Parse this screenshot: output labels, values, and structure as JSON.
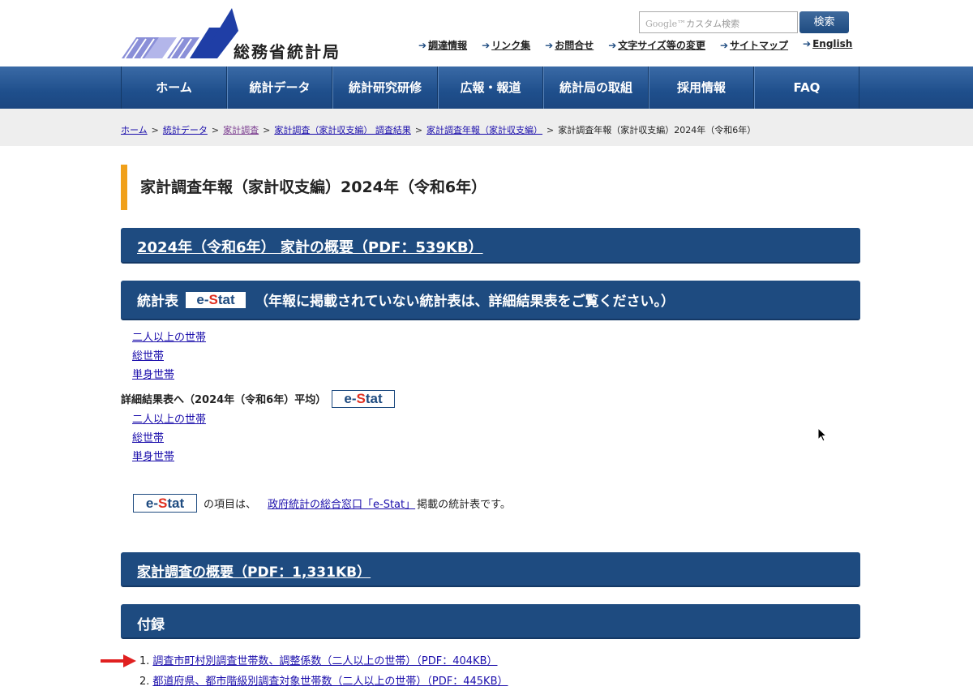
{
  "header": {
    "logo_text": "総務省統計局",
    "search_placeholder_brand": "Google™",
    "search_placeholder": "カスタム検索",
    "search_button": "検索",
    "util_links": [
      "調達情報",
      "リンク集",
      "お問合せ",
      "文字サイズ等の変更",
      "サイトマップ",
      "English"
    ]
  },
  "nav": {
    "items": [
      "ホーム",
      "統計データ",
      "統計研究研修",
      "広報・報道",
      "統計局の取組",
      "採用情報",
      "FAQ"
    ]
  },
  "breadcrumb": [
    "ホーム",
    "統計データ",
    "家計調査",
    "家計調査（家計収支編） 調査結果",
    "家計調査年報（家計収支編）",
    "家計調査年報（家計収支編）2024年（令和6年）"
  ],
  "page_title": "家計調査年報（家計収支編）2024年（令和6年）",
  "summary_link": "2024年（令和6年） 家計の概要（PDF：539KB）",
  "stats_bar": {
    "label": "統計表",
    "estat": "e-Stat",
    "note": "（年報に掲載されていない統計表は、詳細結果表をご覧ください。）"
  },
  "list_1": [
    "二人以上の世帯",
    "総世帯",
    "単身世帯"
  ],
  "detail_label": "詳細結果表へ（2024年（令和6年）平均）",
  "list_2": [
    "二人以上の世帯",
    "総世帯",
    "単身世帯"
  ],
  "note": {
    "before": "の項目は、",
    "link": "政府統計の総合窓口「e-Stat」",
    "after": "掲載の統計表です。"
  },
  "overview_link": "家計調査の概要（PDF：1,331KB）",
  "appendix_title": "付録",
  "appendix_items": [
    {
      "num": "1.",
      "text": "調査市町村別調査世帯数、調整係数（二人以上の世帯）（PDF：404KB）"
    },
    {
      "num": "2.",
      "text": "都道府県、都市階級別調査対象世帯数（二人以上の世帯）（PDF：445KB）"
    }
  ],
  "colors": {
    "nav": "#1e4b80",
    "accent": "#f0a01a",
    "arrow": "#e02020"
  }
}
